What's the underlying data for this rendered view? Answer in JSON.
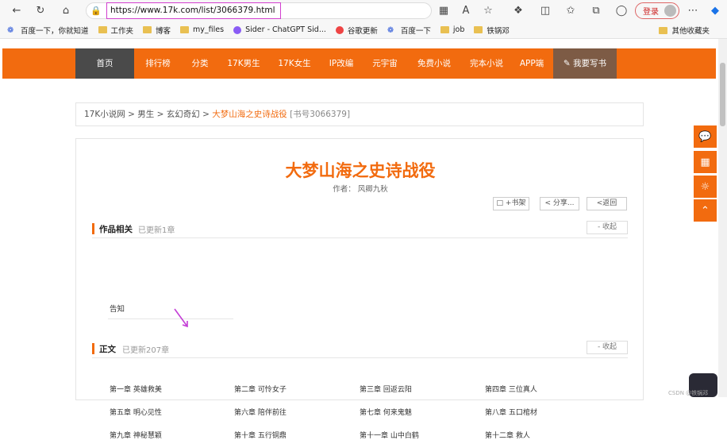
{
  "browser": {
    "url": "https://www.17k.com/list/3066379.html",
    "login_label": "登录",
    "icons": [
      "back-icon",
      "refresh-icon",
      "home-icon",
      "lock-icon",
      "qr-icon",
      "read-aloud-icon",
      "star-icon",
      "extension-icon",
      "split-icon",
      "favorites-icon",
      "collections-icon",
      "shield-icon",
      "more-icon",
      "copilot-icon"
    ]
  },
  "bookmarks": {
    "items": [
      {
        "label": "百度一下，你就知道",
        "icon": "paw-icon"
      },
      {
        "label": "工作夹",
        "icon": "folder-icon"
      },
      {
        "label": "博客",
        "icon": "folder-icon"
      },
      {
        "label": "my_files",
        "icon": "folder-icon"
      },
      {
        "label": "Sider - ChatGPT Sid...",
        "icon": "sider-icon"
      },
      {
        "label": "谷歌更新",
        "icon": "chrome-icon"
      },
      {
        "label": "百度一下",
        "icon": "paw-icon"
      },
      {
        "label": "job",
        "icon": "folder-icon"
      },
      {
        "label": "铁锅邓",
        "icon": "folder-icon"
      }
    ],
    "other": "其他收藏夹"
  },
  "nav": {
    "items": [
      "首页",
      "排行榜",
      "分类",
      "17K男生",
      "17K女生",
      "IP改编",
      "元宇宙",
      "免费小说",
      "完本小说",
      "APP端",
      "✎ 我要写书"
    ],
    "accent": "#f26b0f"
  },
  "breadcrumb": {
    "root": "17K小说网",
    "sep": ">",
    "cat1": "男生",
    "cat2": "玄幻奇幻",
    "current": "大梦山海之史诗战役",
    "book_no": "[书号3066379]"
  },
  "book": {
    "title": "大梦山海之史诗战役",
    "author": "作者：   风卿九秋",
    "buttons": {
      "shelf": "+书架",
      "share": "分享...",
      "back": "<返回"
    }
  },
  "related": {
    "title": "作品相关",
    "sub": "已更新1章",
    "collapse": "- 收起",
    "chapters": [
      "告知"
    ]
  },
  "main": {
    "title": "正文",
    "sub": "已更新207章",
    "collapse": "- 收起",
    "chapters": [
      "第一章 英雄救美",
      "第二章 可怜女子",
      "第三章 回返云阳",
      "第四章 三位真人",
      "第五章 明心见性",
      "第六章 陪伴前往",
      "第七章 何来鬼魅",
      "第八章 五口棺材",
      "第九章 神秘慧颖",
      "第十章 五行铜鼎",
      "第十一章 山中白鹤",
      "第十二章 救人"
    ]
  },
  "watermark": "CSDN @铁锅邓"
}
